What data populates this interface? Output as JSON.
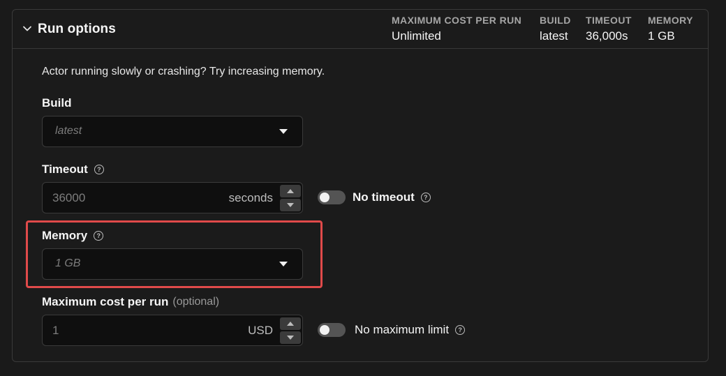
{
  "header": {
    "title": "Run options",
    "summary": [
      {
        "label": "MAXIMUM COST PER RUN",
        "value": "Unlimited"
      },
      {
        "label": "BUILD",
        "value": "latest"
      },
      {
        "label": "TIMEOUT",
        "value": "36,000s"
      },
      {
        "label": "MEMORY",
        "value": "1 GB"
      }
    ]
  },
  "hint": "Actor running slowly or crashing? Try increasing memory.",
  "build": {
    "label": "Build",
    "value": "latest"
  },
  "timeout": {
    "label": "Timeout",
    "value": "36000",
    "unit": "seconds",
    "toggle_label": "No timeout",
    "toggle_on": false
  },
  "memory": {
    "label": "Memory",
    "value": "1 GB"
  },
  "max_cost": {
    "label": "Maximum cost per run",
    "optional": "(optional)",
    "value": "1",
    "unit": "USD",
    "toggle_label": "No maximum limit",
    "toggle_on": false
  },
  "icons": {
    "help": "?",
    "collapse": "chevron-down-icon"
  },
  "colors": {
    "highlight": "#e04a4a",
    "background": "#1a1a1a",
    "input_background": "#0f0f0f"
  }
}
